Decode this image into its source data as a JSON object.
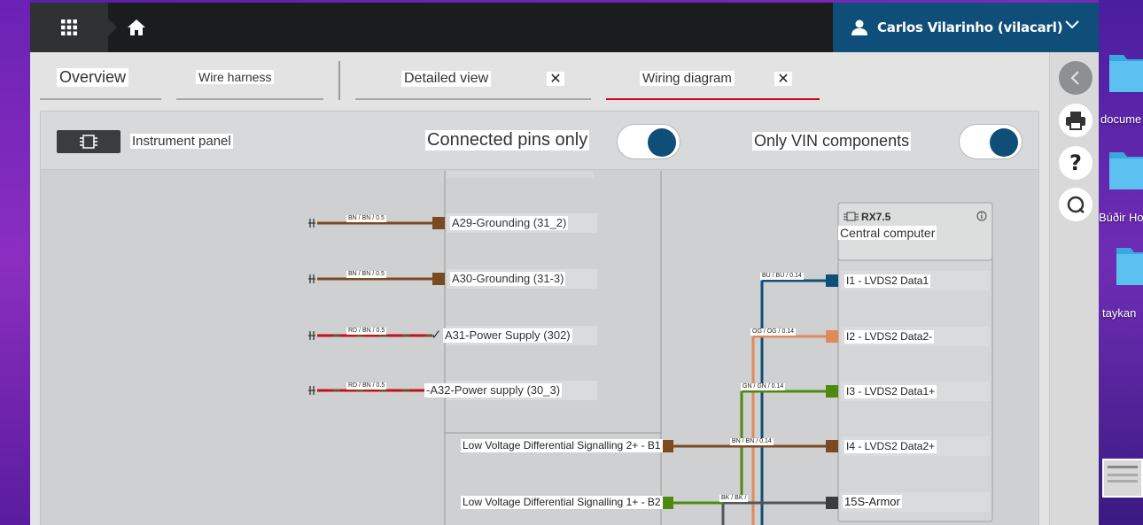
{
  "topbar": {
    "user_name": "Carlos Vilarinho (vilacarl)"
  },
  "tabs": [
    {
      "label": "Overview",
      "closable": false,
      "active": false
    },
    {
      "label": "Wire harness",
      "closable": false,
      "active": false
    },
    {
      "label": "Detailed view",
      "closable": true,
      "active": false
    },
    {
      "label": "Wiring diagram",
      "closable": true,
      "active": true
    }
  ],
  "close_symbol": "✕",
  "panel": {
    "component_name": "Instrument panel",
    "toggle_connected_label": "Connected pins only",
    "toggle_connected_on": true,
    "toggle_vin_label": "Only VIN components",
    "toggle_vin_on": true
  },
  "left_pins": [
    {
      "label": "A29-Grounding (31_2)",
      "wire": "BN / BN / 0.5",
      "color": "#7a4a20"
    },
    {
      "label": "A30-Grounding (31-3)",
      "wire": "BN / BN / 0.5",
      "color": "#7a4a20"
    },
    {
      "label": "A31-Power Supply (302)",
      "wire": "RD / BN / 0.5",
      "color": "#c0121d",
      "checked": true
    },
    {
      "label": "-A32-Power supply (30_3)",
      "wire": "RD / BN / 0.5",
      "color": "#c0121d"
    }
  ],
  "check_mark": "✓",
  "lvds_pins": [
    {
      "label": "Low Voltage Differential Signalling 2+ - B1",
      "wire": "BN / BN / 0.14",
      "color": "#7a4a20"
    },
    {
      "label": "Low Voltage Differential Signalling 1+ - B2",
      "wire": "BK / BK /",
      "color": "#4f8a10"
    }
  ],
  "computer": {
    "code": "RX7.5",
    "name": "Central computer",
    "pins": [
      {
        "label": "I1 - LVDS2 Data1",
        "wire": "BU / BU / 0.14",
        "color": "#0f4e78"
      },
      {
        "label": "I2 - LVDS2 Data2-",
        "wire": "OG / OG / 0.14",
        "color": "#e08a5a"
      },
      {
        "label": "I3 - LVDS2 Data1+",
        "wire": "GN / GN / 0.14",
        "color": "#4f8a10"
      },
      {
        "label": "I4 - LVDS2 Data2+",
        "wire": "BN / BN / 0.14",
        "color": "#7a4a20"
      },
      {
        "label": "15S-Armor",
        "wire": "",
        "color": "#3a3c3e"
      }
    ]
  },
  "desktop": {
    "items": [
      "docume",
      "Búðir Ho",
      "taykan"
    ]
  }
}
